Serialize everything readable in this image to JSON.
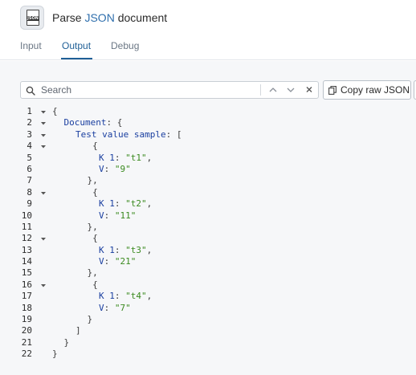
{
  "header": {
    "title_prefix": "Parse ",
    "title_highlight": "JSON",
    "title_suffix": " document",
    "icon_text": "JSON"
  },
  "tabs": [
    {
      "label": "Input"
    },
    {
      "label": "Output",
      "active": true
    },
    {
      "label": "Debug"
    }
  ],
  "search": {
    "placeholder": "Search",
    "value": ""
  },
  "toolbar": {
    "copy_label": "Copy raw JSON"
  },
  "colors": {
    "accent": "#1f5f96",
    "key": "#1a3fa0",
    "string": "#3a8a1f"
  },
  "code_lines": [
    {
      "n": "1",
      "indent": 0,
      "fold": true,
      "parts": [
        {
          "t": "{",
          "c": "p"
        }
      ]
    },
    {
      "n": "2",
      "indent": 1,
      "fold": true,
      "parts": [
        {
          "t": "Document",
          "c": "k"
        },
        {
          "t": ": {",
          "c": "p"
        }
      ]
    },
    {
      "n": "3",
      "indent": 2,
      "fold": true,
      "parts": [
        {
          "t": "Test value sample",
          "c": "k"
        },
        {
          "t": ": [",
          "c": "p"
        }
      ]
    },
    {
      "n": "4",
      "indent": 3,
      "fold": true,
      "parts": [
        {
          "t": " {",
          "c": "p"
        }
      ]
    },
    {
      "n": "5",
      "indent": 4,
      "fold": false,
      "parts": [
        {
          "t": "K 1",
          "c": "k"
        },
        {
          "t": ": ",
          "c": "p"
        },
        {
          "t": "\"t1\"",
          "c": "s"
        },
        {
          "t": ",",
          "c": "p"
        }
      ]
    },
    {
      "n": "6",
      "indent": 4,
      "fold": false,
      "parts": [
        {
          "t": "V",
          "c": "k"
        },
        {
          "t": ": ",
          "c": "p"
        },
        {
          "t": "\"9\"",
          "c": "s"
        }
      ]
    },
    {
      "n": "7",
      "indent": 3,
      "fold": false,
      "parts": [
        {
          "t": "},",
          "c": "p"
        }
      ]
    },
    {
      "n": "8",
      "indent": 3,
      "fold": true,
      "parts": [
        {
          "t": " {",
          "c": "p"
        }
      ]
    },
    {
      "n": "9",
      "indent": 4,
      "fold": false,
      "parts": [
        {
          "t": "K 1",
          "c": "k"
        },
        {
          "t": ": ",
          "c": "p"
        },
        {
          "t": "\"t2\"",
          "c": "s"
        },
        {
          "t": ",",
          "c": "p"
        }
      ]
    },
    {
      "n": "10",
      "indent": 4,
      "fold": false,
      "parts": [
        {
          "t": "V",
          "c": "k"
        },
        {
          "t": ": ",
          "c": "p"
        },
        {
          "t": "\"11\"",
          "c": "s"
        }
      ]
    },
    {
      "n": "11",
      "indent": 3,
      "fold": false,
      "parts": [
        {
          "t": "},",
          "c": "p"
        }
      ]
    },
    {
      "n": "12",
      "indent": 3,
      "fold": true,
      "parts": [
        {
          "t": " {",
          "c": "p"
        }
      ]
    },
    {
      "n": "13",
      "indent": 4,
      "fold": false,
      "parts": [
        {
          "t": "K 1",
          "c": "k"
        },
        {
          "t": ": ",
          "c": "p"
        },
        {
          "t": "\"t3\"",
          "c": "s"
        },
        {
          "t": ",",
          "c": "p"
        }
      ]
    },
    {
      "n": "14",
      "indent": 4,
      "fold": false,
      "parts": [
        {
          "t": "V",
          "c": "k"
        },
        {
          "t": ": ",
          "c": "p"
        },
        {
          "t": "\"21\"",
          "c": "s"
        }
      ]
    },
    {
      "n": "15",
      "indent": 3,
      "fold": false,
      "parts": [
        {
          "t": "},",
          "c": "p"
        }
      ]
    },
    {
      "n": "16",
      "indent": 3,
      "fold": true,
      "parts": [
        {
          "t": " {",
          "c": "p"
        }
      ]
    },
    {
      "n": "17",
      "indent": 4,
      "fold": false,
      "parts": [
        {
          "t": "K 1",
          "c": "k"
        },
        {
          "t": ": ",
          "c": "p"
        },
        {
          "t": "\"t4\"",
          "c": "s"
        },
        {
          "t": ",",
          "c": "p"
        }
      ]
    },
    {
      "n": "18",
      "indent": 4,
      "fold": false,
      "parts": [
        {
          "t": "V",
          "c": "k"
        },
        {
          "t": ": ",
          "c": "p"
        },
        {
          "t": "\"7\"",
          "c": "s"
        }
      ]
    },
    {
      "n": "19",
      "indent": 3,
      "fold": false,
      "parts": [
        {
          "t": "}",
          "c": "p"
        }
      ]
    },
    {
      "n": "20",
      "indent": 2,
      "fold": false,
      "parts": [
        {
          "t": "]",
          "c": "p"
        }
      ]
    },
    {
      "n": "21",
      "indent": 1,
      "fold": false,
      "parts": [
        {
          "t": "}",
          "c": "p"
        }
      ]
    },
    {
      "n": "22",
      "indent": 0,
      "fold": false,
      "parts": [
        {
          "t": "}",
          "c": "p"
        }
      ]
    }
  ]
}
